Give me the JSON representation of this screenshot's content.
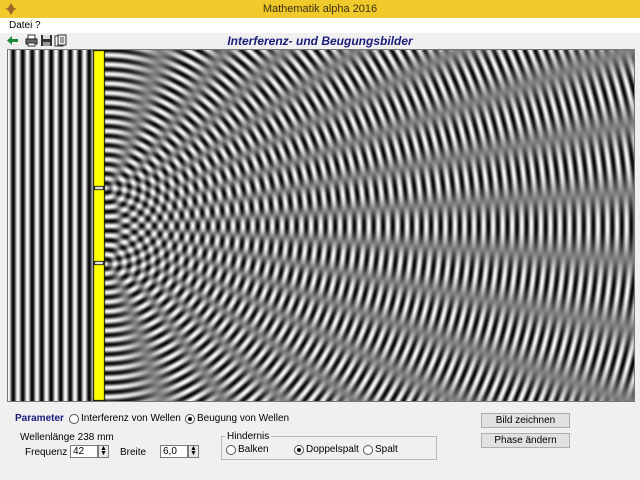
{
  "window": {
    "title": "Mathematik alpha 2016"
  },
  "menu": {
    "items": [
      "Datei",
      "?"
    ]
  },
  "toolbar": {
    "icons": [
      "arrow-icon",
      "print-icon",
      "save-icon",
      "copy-icon"
    ]
  },
  "panel": {
    "title": "Interferenz- und Beugungsbilder"
  },
  "parameter": {
    "title": "Parameter",
    "mode_options": [
      "Interferenz von Wellen",
      "Beugung von Wellen"
    ],
    "mode_selected": "Beugung von Wellen",
    "wavelength_text": "Wellenlänge 238 mm",
    "frequency_label": "Frequenz",
    "frequency_value": "42",
    "width_label": "Breite",
    "width_value": "6,0"
  },
  "obstacle": {
    "title": "Hindernis",
    "options": [
      "Balken",
      "Doppelspalt",
      "Spalt"
    ],
    "selected": "Doppelspalt"
  },
  "buttons": {
    "draw": "Bild zeichnen",
    "phase": "Phase ändern"
  },
  "colors": {
    "barrier": "#ffff00",
    "title_bar": "#f0c92a",
    "panel_title": "#1b1b7a"
  }
}
